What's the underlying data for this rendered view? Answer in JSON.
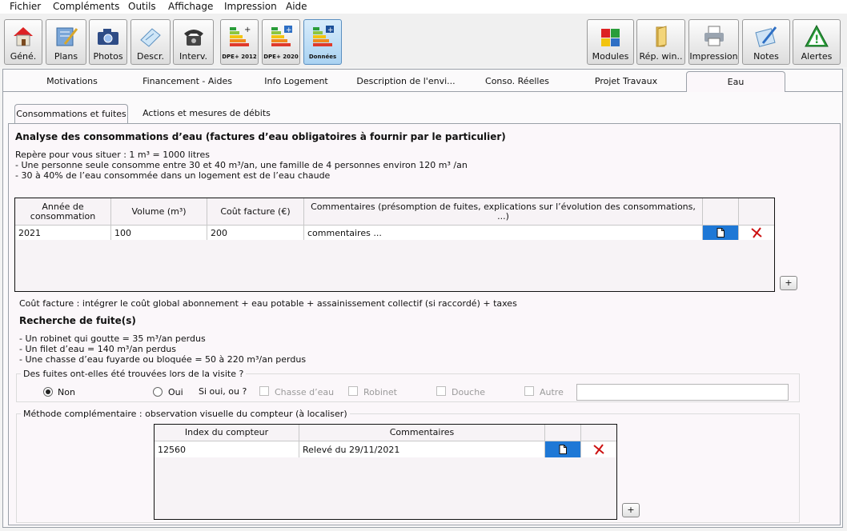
{
  "menu": [
    "Fichier",
    "Compléments",
    "Outils",
    "Affichage",
    "Impression",
    "Aide"
  ],
  "toolbar": {
    "left": [
      {
        "label": "Géné.",
        "icon": "house-icon"
      },
      {
        "label": "Plans",
        "icon": "plans-icon"
      },
      {
        "label": "Photos",
        "icon": "camera-icon"
      },
      {
        "label": "Descr.",
        "icon": "description-icon"
      },
      {
        "label": "Interv.",
        "icon": "phone-icon"
      }
    ],
    "dpe": [
      {
        "label": "DPE+ 2012",
        "icon": "energy-label-icon"
      },
      {
        "label": "DPE+ 2020",
        "icon": "energy-label-icon"
      },
      {
        "label": "Données",
        "icon": "energy-data-icon"
      }
    ],
    "right": [
      {
        "label": "Modules",
        "icon": "puzzle-icon"
      },
      {
        "label": "Rép. win..",
        "icon": "folder-icon"
      },
      {
        "label": "Impression",
        "icon": "printer-icon"
      },
      {
        "label": "Notes",
        "icon": "notes-icon"
      },
      {
        "label": "Alertes",
        "icon": "alert-icon"
      }
    ]
  },
  "tabs": [
    "Motivations",
    "Financement  - Aides",
    "Info Logement",
    "Description de l'envi...",
    "Conso. Réelles",
    "Projet Travaux",
    "Eau"
  ],
  "subtabs": [
    "Consommations et fuites",
    "Actions et mesures de débits"
  ],
  "analysis": {
    "title": "Analyse des consommations d’eau (factures d’eau obligatoires à fournir par le particulier)",
    "lines": [
      "Repère pour vous situer : 1 m³ = 1000 litres",
      "- Une personne seule consomme entre 30 et 40 m³/an, une famille de 4 personnes environ 120 m³ /an",
      "- 30 à 40% de l’eau consommée dans un logement est de l’eau chaude"
    ]
  },
  "conso_table": {
    "headers": [
      "Année de consommation",
      "Volume (m³)",
      "Coût facture (€)",
      "Commentaires (présomption de fuites, explications sur l’évolution des consommations, ...)"
    ],
    "rows": [
      [
        "2021",
        "100",
        "200",
        "commentaires ..."
      ]
    ]
  },
  "cout_note": "Coût facture : intégrer le coût global abonnement + eau potable + assainissement collectif (si raccordé) + taxes",
  "fuite": {
    "title": "Recherche de fuite(s)",
    "lines": [
      "- Un robinet qui goutte = 35 m³/an perdus",
      "- Un filet d’eau = 140 m³/an perdus",
      "- Une chasse d’eau fuyarde ou bloquée = 50 à 220 m³/an perdus"
    ],
    "question": "Des fuites ont-elles été trouvées lors de la visite ?",
    "non": "Non",
    "oui": "Oui",
    "si_oui": "Si oui, ou ?",
    "options": [
      "Chasse d’eau",
      "Robinet",
      "Douche",
      "Autre"
    ],
    "selected": "Non"
  },
  "methode": {
    "legend": "Méthode complémentaire : observation visuelle du compteur (à localiser)",
    "headers": [
      "Index du compteur",
      "Commentaires"
    ],
    "rows": [
      [
        "12560",
        "Relevé du 29/11/2021"
      ]
    ]
  },
  "plus_label": "+",
  "colors": {
    "doc_button": "#1e78d6",
    "delete": "#cc1111"
  }
}
